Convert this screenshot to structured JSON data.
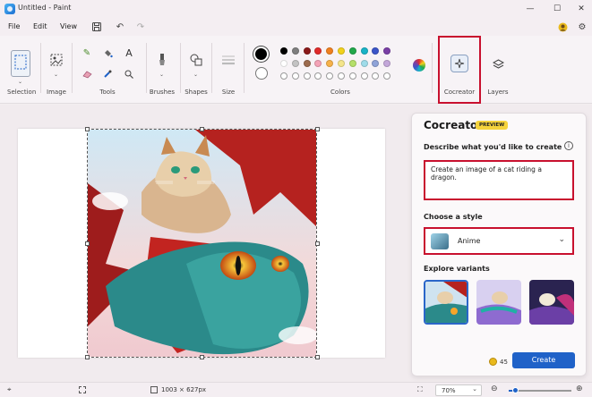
{
  "window": {
    "title": "Untitled - Paint",
    "minimize_glyph": "—",
    "maximize_glyph": "☐",
    "close_glyph": "✕"
  },
  "menu": {
    "items": [
      "File",
      "Edit",
      "View"
    ]
  },
  "ribbon": {
    "groups": {
      "selection": "Selection",
      "image": "Image",
      "tools": "Tools",
      "brushes": "Brushes",
      "shapes": "Shapes",
      "size": "Size",
      "colors": "Colors",
      "cocreator": "Cocreator",
      "layers": "Layers"
    },
    "palette_row1": [
      "#000000",
      "#7f7f7f",
      "#8b1a1a",
      "#e02b2b",
      "#f0801f",
      "#f2d21c",
      "#21a84a",
      "#18b3c7",
      "#3b55c9",
      "#7a3fa6"
    ],
    "palette_row2": [
      "#ffffff",
      "#c3c3c3",
      "#9c6b4e",
      "#f4a3b7",
      "#f7b24a",
      "#f4e58a",
      "#b5e06a",
      "#9fdcea",
      "#8fa3d8",
      "#c3a7d9"
    ],
    "palette_row3": [
      "",
      "",
      "",
      "",
      "",
      "",
      "",
      "",
      "",
      ""
    ]
  },
  "cocreator_panel": {
    "title": "Cocreator",
    "badge": "PREVIEW",
    "prompt_label": "Describe what you'd like to create",
    "prompt_value": "Create an image of a cat riding a dragon.",
    "style_label": "Choose a style",
    "style_value": "Anime",
    "variants_label": "Explore variants",
    "credits": "45",
    "create_label": "Create",
    "highlight_color": "#c8102e",
    "accent_color": "#1f62c8"
  },
  "status": {
    "canvas_size": "1003 × 627px",
    "zoom": "70%"
  }
}
